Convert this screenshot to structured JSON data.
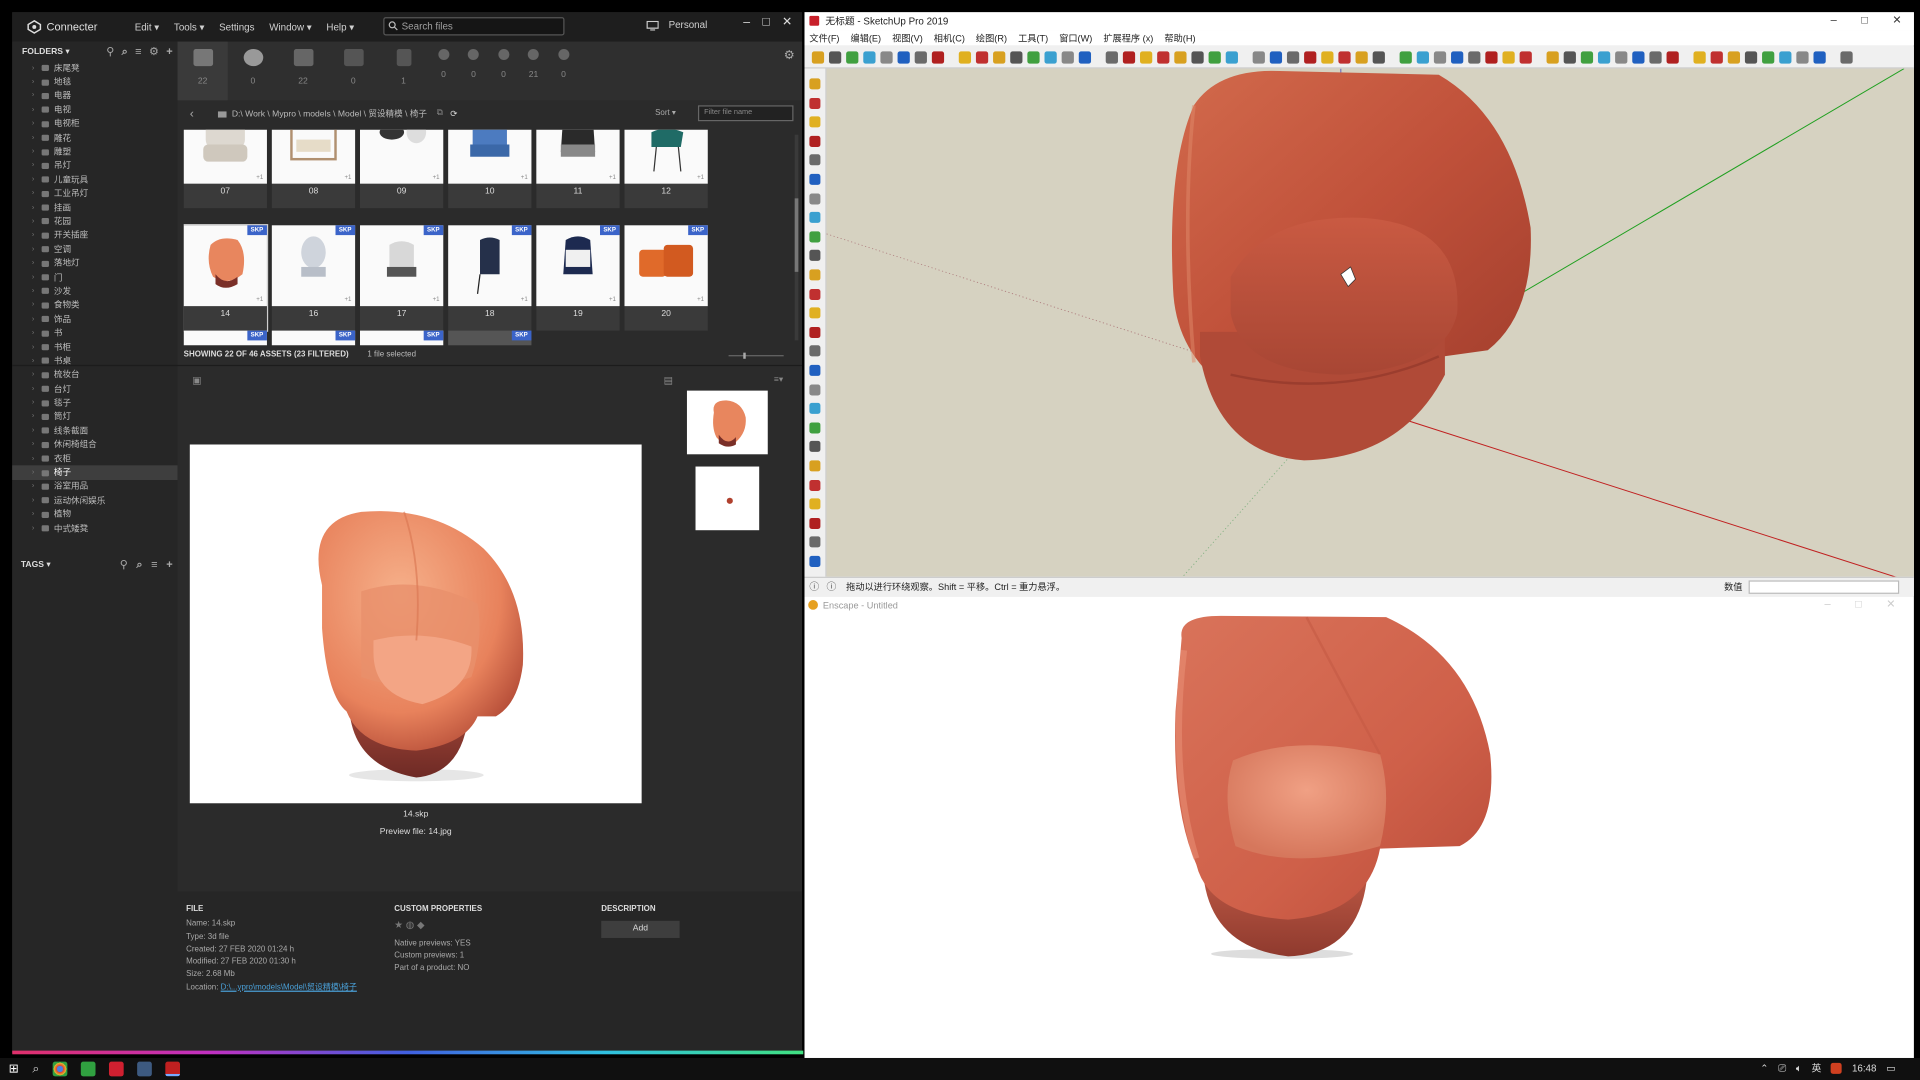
{
  "connecter": {
    "app_name": "Connecter",
    "menu": [
      "Edit ▾",
      "Tools ▾",
      "Settings",
      "Window ▾",
      "Help ▾"
    ],
    "search_placeholder": "Search files",
    "workspace": "Personal",
    "folders_header": "FOLDERS ▾",
    "tags_header": "TAGS ▾",
    "folders": [
      "床尾凳",
      "地毯",
      "电器",
      "电视",
      "电视柜",
      "雕花",
      "雕塑",
      "吊灯",
      "儿童玩具",
      "工业吊灯",
      "挂画",
      "花园",
      "开关插座",
      "空调",
      "落地灯",
      "门",
      "沙发",
      "食物类",
      "饰品",
      "书",
      "书柜",
      "书桌",
      "梳妆台",
      "台灯",
      "毯子",
      "筒灯",
      "线条截面",
      "休闲椅组合",
      "衣柜",
      "椅子",
      "浴室用品",
      "运动休闲娱乐",
      "植物",
      "中式矮凳"
    ],
    "selected_folder": "椅子",
    "filter_counts": [
      "22",
      "0",
      "22",
      "0",
      "1",
      "0",
      "0",
      "0",
      "21",
      "0"
    ],
    "path": "D:\\ Work \\ Mypro \\ models \\ Model \\ 贸设精模 \\ 椅子",
    "sort_label": "Sort ▾",
    "filter_placeholder": "Filter file name",
    "tiles_row1": [
      "07",
      "08",
      "09",
      "10",
      "11",
      "12"
    ],
    "tiles_row2": [
      "14",
      "16",
      "17",
      "18",
      "19",
      "20"
    ],
    "skp_badge": "SKP",
    "plus_badge": "+1",
    "status_count": "SHOWING 22 OF 46 ASSETS (23 FILTERED)",
    "status_selected": "1 file selected",
    "preview_name": "14.skp",
    "preview_file": "Preview file: 14.jpg",
    "file": {
      "header": "FILE",
      "name": "Name:  14.skp",
      "type": "Type: 3d file",
      "created": "Created: 27 FEB 2020 01:24 h",
      "modified": "Modified: 27 FEB 2020 01:30 h",
      "size": "Size: 2.68 Mb",
      "location_label": "Location:",
      "location_value": "D:\\...ypro\\models\\Model\\贸设精模\\椅子"
    },
    "custom": {
      "header": "CUSTOM PROPERTIES",
      "native": "Native previews: YES",
      "custom_previews": "Custom previews: 1",
      "product": "Part of a product: NO"
    },
    "description": {
      "header": "DESCRIPTION",
      "add": "Add"
    }
  },
  "sketchup": {
    "title": "无标题 - SketchUp Pro 2019",
    "menu": [
      "文件(F)",
      "编辑(E)",
      "视图(V)",
      "相机(C)",
      "绘图(R)",
      "工具(T)",
      "窗口(W)",
      "扩展程序 (x)",
      "帮助(H)"
    ],
    "status": "拖动以进行环绕观察。Shift = 平移。Ctrl = 重力悬浮。",
    "measure_label": "数值"
  },
  "enscape": {
    "title": "Enscape - Untitled"
  },
  "taskbar": {
    "lang": "英",
    "time": "16:48"
  },
  "colors": {
    "chair": "#c8533a",
    "chair_light": "#f0a07c",
    "skp_badge": "#3b64c9",
    "viewport_bg": "#d6d2c1"
  }
}
